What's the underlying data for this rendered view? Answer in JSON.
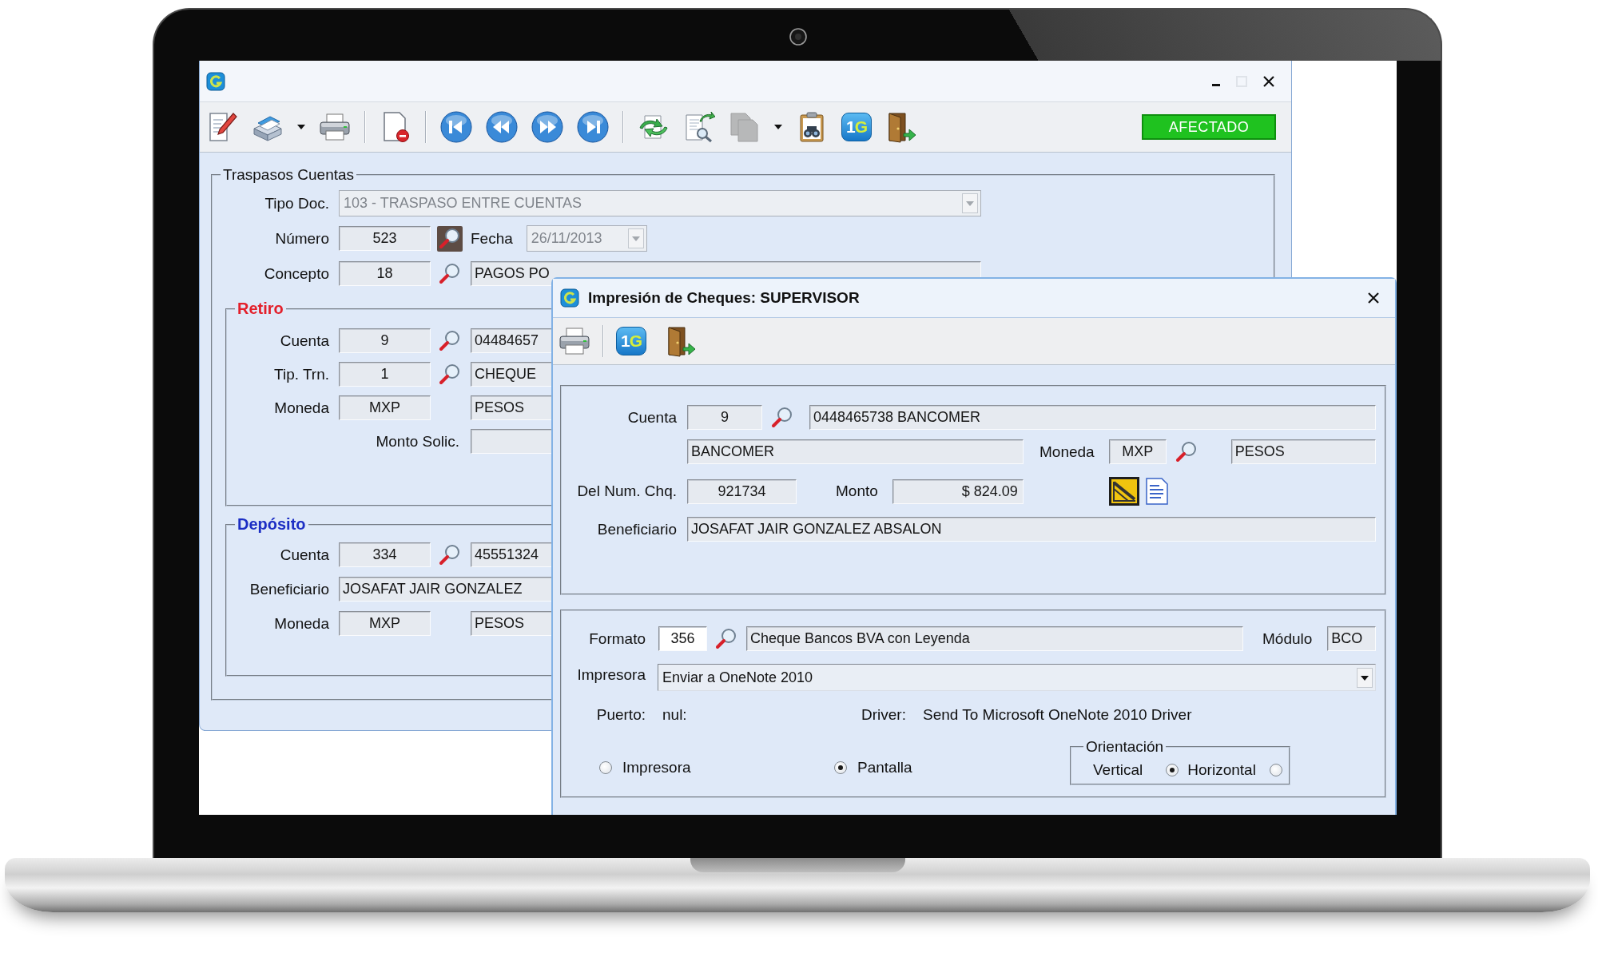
{
  "main_window": {
    "controls": [
      {
        "kind": "minimize",
        "disabled": false
      },
      {
        "kind": "maximize",
        "disabled": true
      },
      {
        "kind": "close",
        "disabled": false
      }
    ],
    "toolbar_groups": [
      {
        "buttons": [
          {
            "kind": "edit",
            "disabled": false,
            "dropdown": false
          },
          {
            "kind": "archive",
            "disabled": false,
            "dropdown": true
          },
          {
            "kind": "print",
            "disabled": false,
            "dropdown": false
          }
        ]
      },
      {
        "buttons": [
          {
            "kind": "delete",
            "disabled": false,
            "dropdown": false
          }
        ]
      },
      {
        "buttons": [
          {
            "kind": "first",
            "disabled": false,
            "dropdown": false
          },
          {
            "kind": "previous",
            "disabled": false,
            "dropdown": false
          },
          {
            "kind": "next",
            "disabled": false,
            "dropdown": false
          },
          {
            "kind": "last",
            "disabled": false,
            "dropdown": false
          }
        ]
      },
      {
        "buttons": [
          {
            "kind": "refresh",
            "disabled": false,
            "dropdown": false
          },
          {
            "kind": "find",
            "disabled": false,
            "dropdown": false
          },
          {
            "kind": "copy",
            "disabled": true,
            "dropdown": true
          },
          {
            "kind": "report",
            "disabled": false,
            "dropdown": false
          },
          {
            "kind": "logo",
            "text": "1G",
            "disabled": false,
            "dropdown": false
          },
          {
            "kind": "exit",
            "disabled": false,
            "dropdown": false
          }
        ]
      }
    ],
    "status": "AFECTADO",
    "form": {
      "title": "Traspasos Cuentas",
      "tipo_doc": {
        "label": "Tipo Doc.",
        "value": "103 - TRASPASO ENTRE CUENTAS",
        "disabled": true
      },
      "numero": {
        "label": "Número",
        "value": "523",
        "pressed": true
      },
      "fecha": {
        "label": "Fecha",
        "value": "26/11/2013",
        "disabled": true
      },
      "concepto": {
        "label": "Concepto",
        "code": "18",
        "pressed": false,
        "description": "PAGOS PO"
      },
      "retiro": {
        "title": "Retiro",
        "cuenta": {
          "label": "Cuenta",
          "code": "9",
          "pressed": false,
          "description": "04484657"
        },
        "tipo_trn": {
          "label": "Tip. Trn.",
          "code": "1",
          "pressed": false,
          "description": "CHEQUE"
        },
        "moneda": {
          "label": "Moneda",
          "code": "MXP",
          "description": "PESOS"
        },
        "monto_solic": {
          "label": "Monto Solic."
        }
      },
      "deposito": {
        "title": "Depósito",
        "cuenta": {
          "label": "Cuenta",
          "code": "334",
          "pressed": false,
          "description": "45551324"
        },
        "beneficiario": {
          "label": "Beneficiario",
          "value": "JOSAFAT JAIR GONZALEZ"
        },
        "moneda": {
          "label": "Moneda",
          "code": "MXP",
          "description": "PESOS"
        }
      }
    }
  },
  "dialog": {
    "title": "Impresión de Cheques: SUPERVISOR",
    "controls": [
      {
        "kind": "close",
        "disabled": false
      }
    ],
    "toolbar_groups": [
      {
        "buttons": [
          {
            "kind": "print",
            "disabled": false,
            "dropdown": false
          }
        ]
      },
      {
        "buttons": [
          {
            "kind": "logo",
            "text": "1G",
            "disabled": false,
            "dropdown": false
          },
          {
            "kind": "exit",
            "disabled": false,
            "dropdown": false
          }
        ]
      }
    ],
    "cuenta": {
      "label": "Cuenta",
      "code": "9",
      "editable": false,
      "pressed": false,
      "description": "0448465738 BANCOMER"
    },
    "banco": "BANCOMER",
    "moneda": {
      "label": "Moneda",
      "code": "MXP",
      "editable": false,
      "pressed": false,
      "description": "PESOS"
    },
    "num_cheque": {
      "label": "Del Num. Chq.",
      "value": "921734"
    },
    "monto": {
      "label": "Monto",
      "value": "$ 824.09"
    },
    "beneficiario": {
      "label": "Beneficiario",
      "value": "JOSAFAT JAIR GONZALEZ ABSALON"
    },
    "formato": {
      "label": "Formato",
      "code": "356",
      "editable": true,
      "pressed": false,
      "description": "Cheque Bancos BVA con Leyenda"
    },
    "modulo": {
      "label": "Módulo",
      "value": "BCO"
    },
    "impresora": {
      "label": "Impresora",
      "value": "Enviar a OneNote 2010",
      "disabled": false
    },
    "puerto": {
      "label": "Puerto:",
      "value": "nul:"
    },
    "driver": {
      "label": "Driver:",
      "value": "Send To Microsoft OneNote 2010 Driver"
    },
    "output": [
      {
        "label": "Impresora",
        "selected": false
      },
      {
        "label": "Pantalla",
        "selected": true
      }
    ],
    "orientation": {
      "title": "Orientación",
      "options": [
        {
          "label": "Vertical",
          "selected": true
        },
        {
          "label": "Horizontal",
          "selected": false
        }
      ]
    }
  }
}
